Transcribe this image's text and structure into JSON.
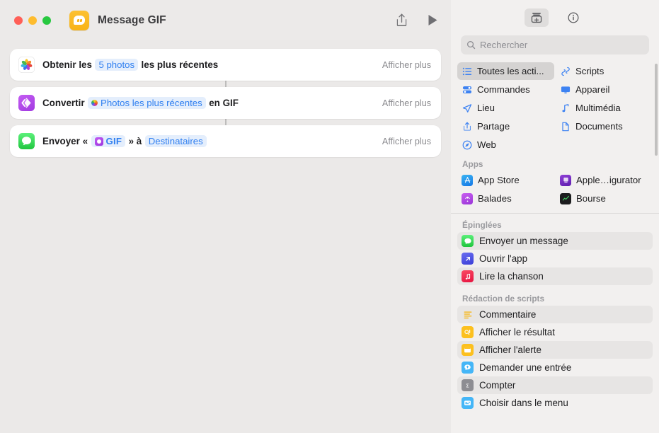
{
  "window": {
    "title": "Message GIF",
    "app_icon": "messages-icon",
    "traffic_lights": [
      "close-button",
      "minimize-button",
      "zoom-button"
    ],
    "toolbar": {
      "share_label": "share-icon",
      "run_label": "run-icon"
    }
  },
  "editor": {
    "actions": [
      {
        "icon": "photos-app-icon",
        "prefix": "Obtenir les",
        "token": "5 photos",
        "token_kind": "plain",
        "suffix": "les plus récentes",
        "show_more": "Afficher plus"
      },
      {
        "icon": "convert-media-icon",
        "prefix": "Convertir",
        "token": "Photos les plus récentes",
        "token_kind": "variable",
        "suffix": "en GIF",
        "show_more": "Afficher plus"
      },
      {
        "icon": "messages-app-icon",
        "prefix": "Envoyer «",
        "token": "GIF",
        "token_kind": "gif",
        "mid": "» à",
        "token2": "Destinataires",
        "show_more": "Afficher plus"
      }
    ]
  },
  "library": {
    "toolbar": {
      "action_library_button": "action-library-icon",
      "info_button": "info-icon"
    },
    "search": {
      "placeholder": "Rechercher",
      "value": "",
      "icon": "search-icon"
    },
    "categories": [
      {
        "label": "Toutes les acti...",
        "icon": "list-icon",
        "selected": true
      },
      {
        "label": "Scripts",
        "icon": "scripts-icon",
        "selected": false
      },
      {
        "label": "Commandes",
        "icon": "controls-icon",
        "selected": false
      },
      {
        "label": "Appareil",
        "icon": "device-icon",
        "selected": false
      },
      {
        "label": "Lieu",
        "icon": "location-icon",
        "selected": false
      },
      {
        "label": "Multimédia",
        "icon": "media-icon",
        "selected": false
      },
      {
        "label": "Partage",
        "icon": "share-icon",
        "selected": false
      },
      {
        "label": "Documents",
        "icon": "documents-icon",
        "selected": false
      },
      {
        "label": "Web",
        "icon": "web-icon",
        "selected": false
      }
    ],
    "apps_header": "Apps",
    "apps": [
      {
        "label": "App Store",
        "icon": "app-store-icon"
      },
      {
        "label": "Apple…igurator",
        "icon": "apple-configurator-icon"
      },
      {
        "label": "Balades",
        "icon": "podcasts-icon"
      },
      {
        "label": "Bourse",
        "icon": "stocks-icon"
      }
    ],
    "pinned_header": "Épinglées",
    "pinned": [
      {
        "label": "Envoyer un message",
        "icon": "messages-icon",
        "striped": true
      },
      {
        "label": "Ouvrir l'app",
        "icon": "open-app-icon",
        "striped": false
      },
      {
        "label": "Lire la chanson",
        "icon": "music-icon",
        "striped": true
      }
    ],
    "scripting_header": "Rédaction de scripts",
    "scripting": [
      {
        "label": "Commentaire",
        "icon": "comment-icon",
        "striped": true
      },
      {
        "label": "Afficher le résultat",
        "icon": "show-result-icon",
        "striped": false
      },
      {
        "label": "Afficher l'alerte",
        "icon": "show-alert-icon",
        "striped": true
      },
      {
        "label": "Demander une entrée",
        "icon": "ask-input-icon",
        "striped": false
      },
      {
        "label": "Compter",
        "icon": "count-icon",
        "striped": true
      },
      {
        "label": "Choisir dans le menu",
        "icon": "choose-menu-icon",
        "striped": false
      }
    ]
  },
  "colors": {
    "accent_blue": "#2f7ff0",
    "token_bg": "#e4eefc",
    "window_bg": "#ebe9e8",
    "library_bg": "#f2f0ef",
    "selected_bg": "#d5d3d2"
  }
}
